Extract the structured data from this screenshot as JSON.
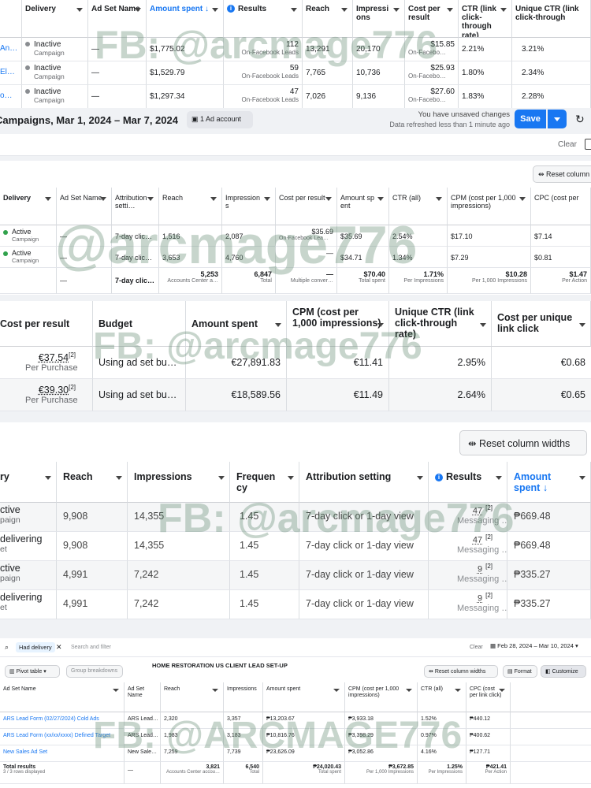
{
  "s1": {
    "headers": [
      "Delivery",
      "Ad Set Name",
      "Amount spent",
      "Results",
      "Reach",
      "Impressions",
      "Cost per result",
      "CTR (link click-through rate)",
      "Unique CTR (link click-through"
    ],
    "rows": [
      {
        "name": "An…",
        "delivery": "Inactive",
        "level": "Campaign",
        "adset": "—",
        "spent": "$1,775.02",
        "results": "112",
        "results_sub": "On-Facebook Leads",
        "reach": "13,291",
        "impr": "20,170",
        "cpr": "$15.85",
        "cpr_sub": "On-Facebo…",
        "ctr": "2.21%",
        "uctr": "3.21%"
      },
      {
        "name": "El…",
        "delivery": "Inactive",
        "level": "Campaign",
        "adset": "—",
        "spent": "$1,529.79",
        "results": "59",
        "results_sub": "On-Facebook Leads",
        "reach": "7,765",
        "impr": "10,736",
        "cpr": "$25.93",
        "cpr_sub": "On-Facebo…",
        "ctr": "1.80%",
        "uctr": "2.34%"
      },
      {
        "name": "o…",
        "delivery": "Inactive",
        "level": "Campaign",
        "adset": "—",
        "spent": "$1,297.34",
        "results": "47",
        "results_sub": "On-Facebook Leads",
        "reach": "7,026",
        "impr": "9,136",
        "cpr": "$27.60",
        "cpr_sub": "On-Facebo…",
        "ctr": "1.83%",
        "uctr": "2.28%"
      }
    ],
    "footer_title": "Campaigns, Mar 1, 2024 – Mar 7, 2024",
    "ad_account": "1 Ad account",
    "unsaved": "You have unsaved changes",
    "refreshed": "Data refreshed less than 1 minute ago",
    "save": "Save",
    "clear": "Clear"
  },
  "s2": {
    "reset": "Reset column",
    "headers": [
      "Delivery",
      "Ad Set Name",
      "Attribution setti…",
      "Reach",
      "Impressions",
      "Cost per result",
      "Amount spent",
      "CTR (all)",
      "CPM (cost per 1,000 impressions)",
      "CPC (cost per"
    ],
    "rows": [
      {
        "delivery": "Active",
        "level": "Campaign",
        "adset": "—",
        "attr": "7-day clic…",
        "reach": "1,516",
        "impr": "2,087",
        "cpr": "$35.69",
        "cpr_sub": "On-Facebook Lea…",
        "spent": "$35.69",
        "ctr": "2.54%",
        "cpm": "$17.10",
        "cpc": "$7.14"
      },
      {
        "delivery": "Active",
        "level": "Campaign",
        "adset": "—",
        "attr": "7-day clic…",
        "reach": "3,653",
        "impr": "4,760",
        "cpr": "—",
        "cpr_sub": "",
        "spent": "$34.71",
        "ctr": "1.34%",
        "cpm": "$7.29",
        "cpc": "$0.81"
      }
    ],
    "total": {
      "adset": "—",
      "attr": "7-day clic…",
      "reach": "5,253",
      "reach_sub": "Accounts Center a…",
      "impr": "6,847",
      "impr_sub": "Total",
      "cpr": "—",
      "cpr_sub": "Multiple conver…",
      "spent": "$70.40",
      "spent_sub": "Total spent",
      "ctr": "1.71%",
      "ctr_sub": "Per Impressions",
      "cpm": "$10.28",
      "cpm_sub": "Per 1,000 Impressions",
      "cpc": "$1.47",
      "cpc_sub": "Per Action"
    }
  },
  "s3": {
    "headers": [
      "Cost per result",
      "Budget",
      "Amount spent",
      "CPM (cost per 1,000 impressions)",
      "Unique CTR (link click-through rate)",
      "Cost per unique link click"
    ],
    "rows": [
      {
        "cpr": "€37.54",
        "sup": "[2]",
        "cpr_sub": "Per Purchase",
        "budget": "Using ad set bu…",
        "spent": "€27,891.83",
        "cpm": "€11.41",
        "uctr": "2.95%",
        "cpu": "€0.68"
      },
      {
        "cpr": "€39.30",
        "sup": "[2]",
        "cpr_sub": "Per Purchase",
        "budget": "Using ad set bu…",
        "spent": "€18,589.56",
        "cpm": "€11.49",
        "uctr": "2.64%",
        "cpu": "€0.65"
      }
    ]
  },
  "s4": {
    "reset": "Reset column widths",
    "headers": [
      "ry",
      "Reach",
      "Impressions",
      "Frequency",
      "Attribution setting",
      "Results",
      "Amount spent"
    ],
    "rows": [
      {
        "d1": "ctive",
        "d2": "paign",
        "reach": "9,908",
        "impr": "14,355",
        "freq": "1.45",
        "attr": "7-day click or 1-day view",
        "res": "47",
        "sup": "[2]",
        "res_sub": "Messaging …",
        "spent": "₱669.48"
      },
      {
        "d1": "delivering",
        "d2": "et",
        "reach": "9,908",
        "impr": "14,355",
        "freq": "1.45",
        "attr": "7-day click or 1-day view",
        "res": "47",
        "sup": "[2]",
        "res_sub": "Messaging …",
        "spent": "₱669.48"
      },
      {
        "d1": "ctive",
        "d2": "paign",
        "reach": "4,991",
        "impr": "7,242",
        "freq": "1.45",
        "attr": "7-day click or 1-day view",
        "res": "9",
        "sup": "[2]",
        "res_sub": "Messaging …",
        "spent": "₱335.27"
      },
      {
        "d1": "delivering",
        "d2": "et",
        "reach": "4,991",
        "impr": "7,242",
        "freq": "1.45",
        "attr": "7-day click or 1-day view",
        "res": "9",
        "sup": "[2]",
        "res_sub": "Messaging …",
        "spent": "₱335.27"
      }
    ]
  },
  "s5": {
    "filter_chip": "Had delivery",
    "search_placeholder": "Search and filter",
    "clear": "Clear",
    "date": "Feb 28, 2024 – Mar 10, 2024",
    "title": "HOME RESTORATION US CLIENT LEAD SET-UP",
    "pivot": "Pivot table",
    "breakdowns": "Group breakdowns",
    "reset": "Reset column widths",
    "format": "Format",
    "customize": "Customize",
    "headers": [
      "Ad Set Name",
      "Ad Set Name",
      "Reach",
      "Impressions",
      "Amount spent",
      "CPM (cost per 1,000 impressions)",
      "CTR (all)",
      "CPC (cost per link click)"
    ],
    "rows": [
      {
        "name": "ARS Lead Form (02/27/2024) Cold Ads",
        "adset": "ARS Lead…",
        "reach": "2,320",
        "impr": "3,357",
        "spent": "₱13,203.67",
        "cpm": "₱3,933.18",
        "ctr": "1.52%",
        "cpc": "₱440.12"
      },
      {
        "name": "ARS Lead Form (xx/xx/xxxx) Defined Target",
        "adset": "ARS Lead…",
        "reach": "1,983",
        "impr": "3,183",
        "spent": "₱10,816.76",
        "cpm": "₱3,398.29",
        "ctr": "0.97%",
        "cpc": "₱400.62"
      },
      {
        "name": "New Sales Ad Set",
        "adset": "New Sale…",
        "reach": "7,259",
        "impr": "7,739",
        "spent": "₱23,626.09",
        "cpm": "₱3,052.86",
        "ctr": "4.16%",
        "cpc": "₱127.71"
      }
    ],
    "total": {
      "name": "Total results",
      "name_sub": "3 / 3 rows displayed",
      "adset": "—",
      "reach": "3,821",
      "reach_sub": "Accounts Center accou…",
      "impr": "6,540",
      "impr_sub": "Total",
      "spent": "₱24,020.43",
      "spent_sub": "Total spent",
      "cpm": "₱3,672.85",
      "cpm_sub": "Per 1,000 Impressions",
      "ctr": "1.25%",
      "ctr_sub": "Per Impressions",
      "cpc": "₱421.41",
      "cpc_sub": "Per Action"
    }
  },
  "watermarks": {
    "w1": "FB: @arcmage776",
    "w2": "@arcmage776",
    "w3": "FB: @arcmage776",
    "w4": "FB: @arcmage776",
    "w5": "FB: @ARCMAGE776"
  },
  "colors": {
    "accent": "#1877f2",
    "active": "#31a24c",
    "inactive": "#8a8d91"
  }
}
